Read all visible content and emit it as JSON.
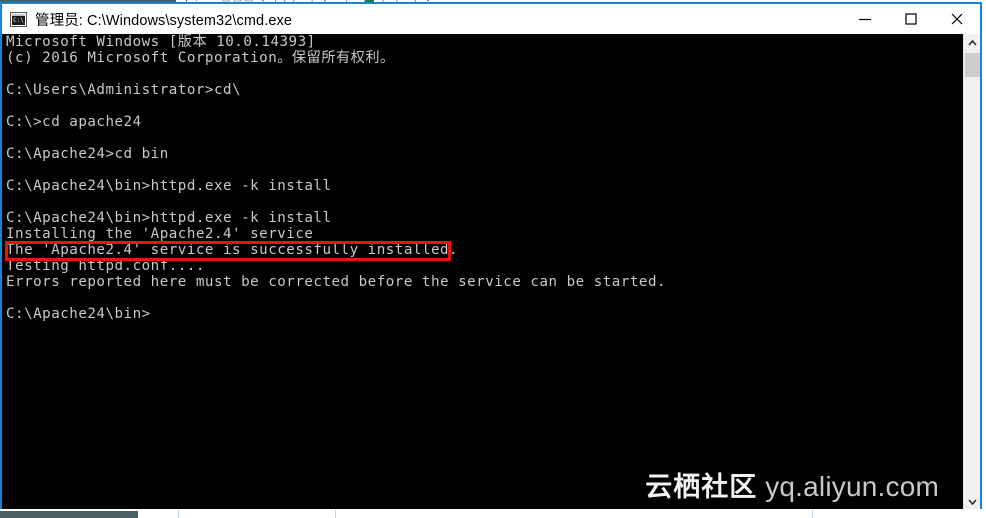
{
  "window": {
    "title": "管理员: C:\\Windows\\system32\\cmd.exe",
    "icon_name": "cmd-console-icon",
    "icon_text": "C:\\_",
    "border_color": "#1883d7",
    "titlebar_bg": "#ffffff",
    "controls": {
      "minimize_label": "最小化",
      "maximize_label": "最大化",
      "close_label": "关闭"
    }
  },
  "console": {
    "background": "#000000",
    "foreground": "#c8c8c8",
    "lines": [
      "Microsoft Windows [版本 10.0.14393]",
      "(c) 2016 Microsoft Corporation。保留所有权利。",
      "",
      "C:\\Users\\Administrator>cd\\",
      "",
      "C:\\>cd apache24",
      "",
      "C:\\Apache24>cd bin",
      "",
      "C:\\Apache24\\bin>httpd.exe -k install",
      "",
      "C:\\Apache24\\bin>httpd.exe -k install",
      "Installing the 'Apache2.4' service",
      "The 'Apache2.4' service is successfully installed.",
      "Testing httpd.conf....",
      "Errors reported here must be corrected before the service can be started.",
      "",
      "C:\\Apache24\\bin>"
    ]
  },
  "annotation": {
    "highlight_color": "#ee1111",
    "highlighted_text": "The 'Apache2.4' service is successfully installed."
  },
  "watermark": {
    "cn": "云栖社区",
    "en": "yq.aliyun.com"
  },
  "scrollbar": {
    "up_arrow_name": "scroll-up-arrow",
    "down_arrow_name": "scroll-down-arrow",
    "thumb_name": "scroll-thumb"
  },
  "background": {
    "top_strip_glyphs": "▾  ⌐  ╶  ▭▭▭  ▾  ┌┬┐┴┤  ▾  ┴┬┴┬┴┬ ┬┴┤  ▾"
  }
}
